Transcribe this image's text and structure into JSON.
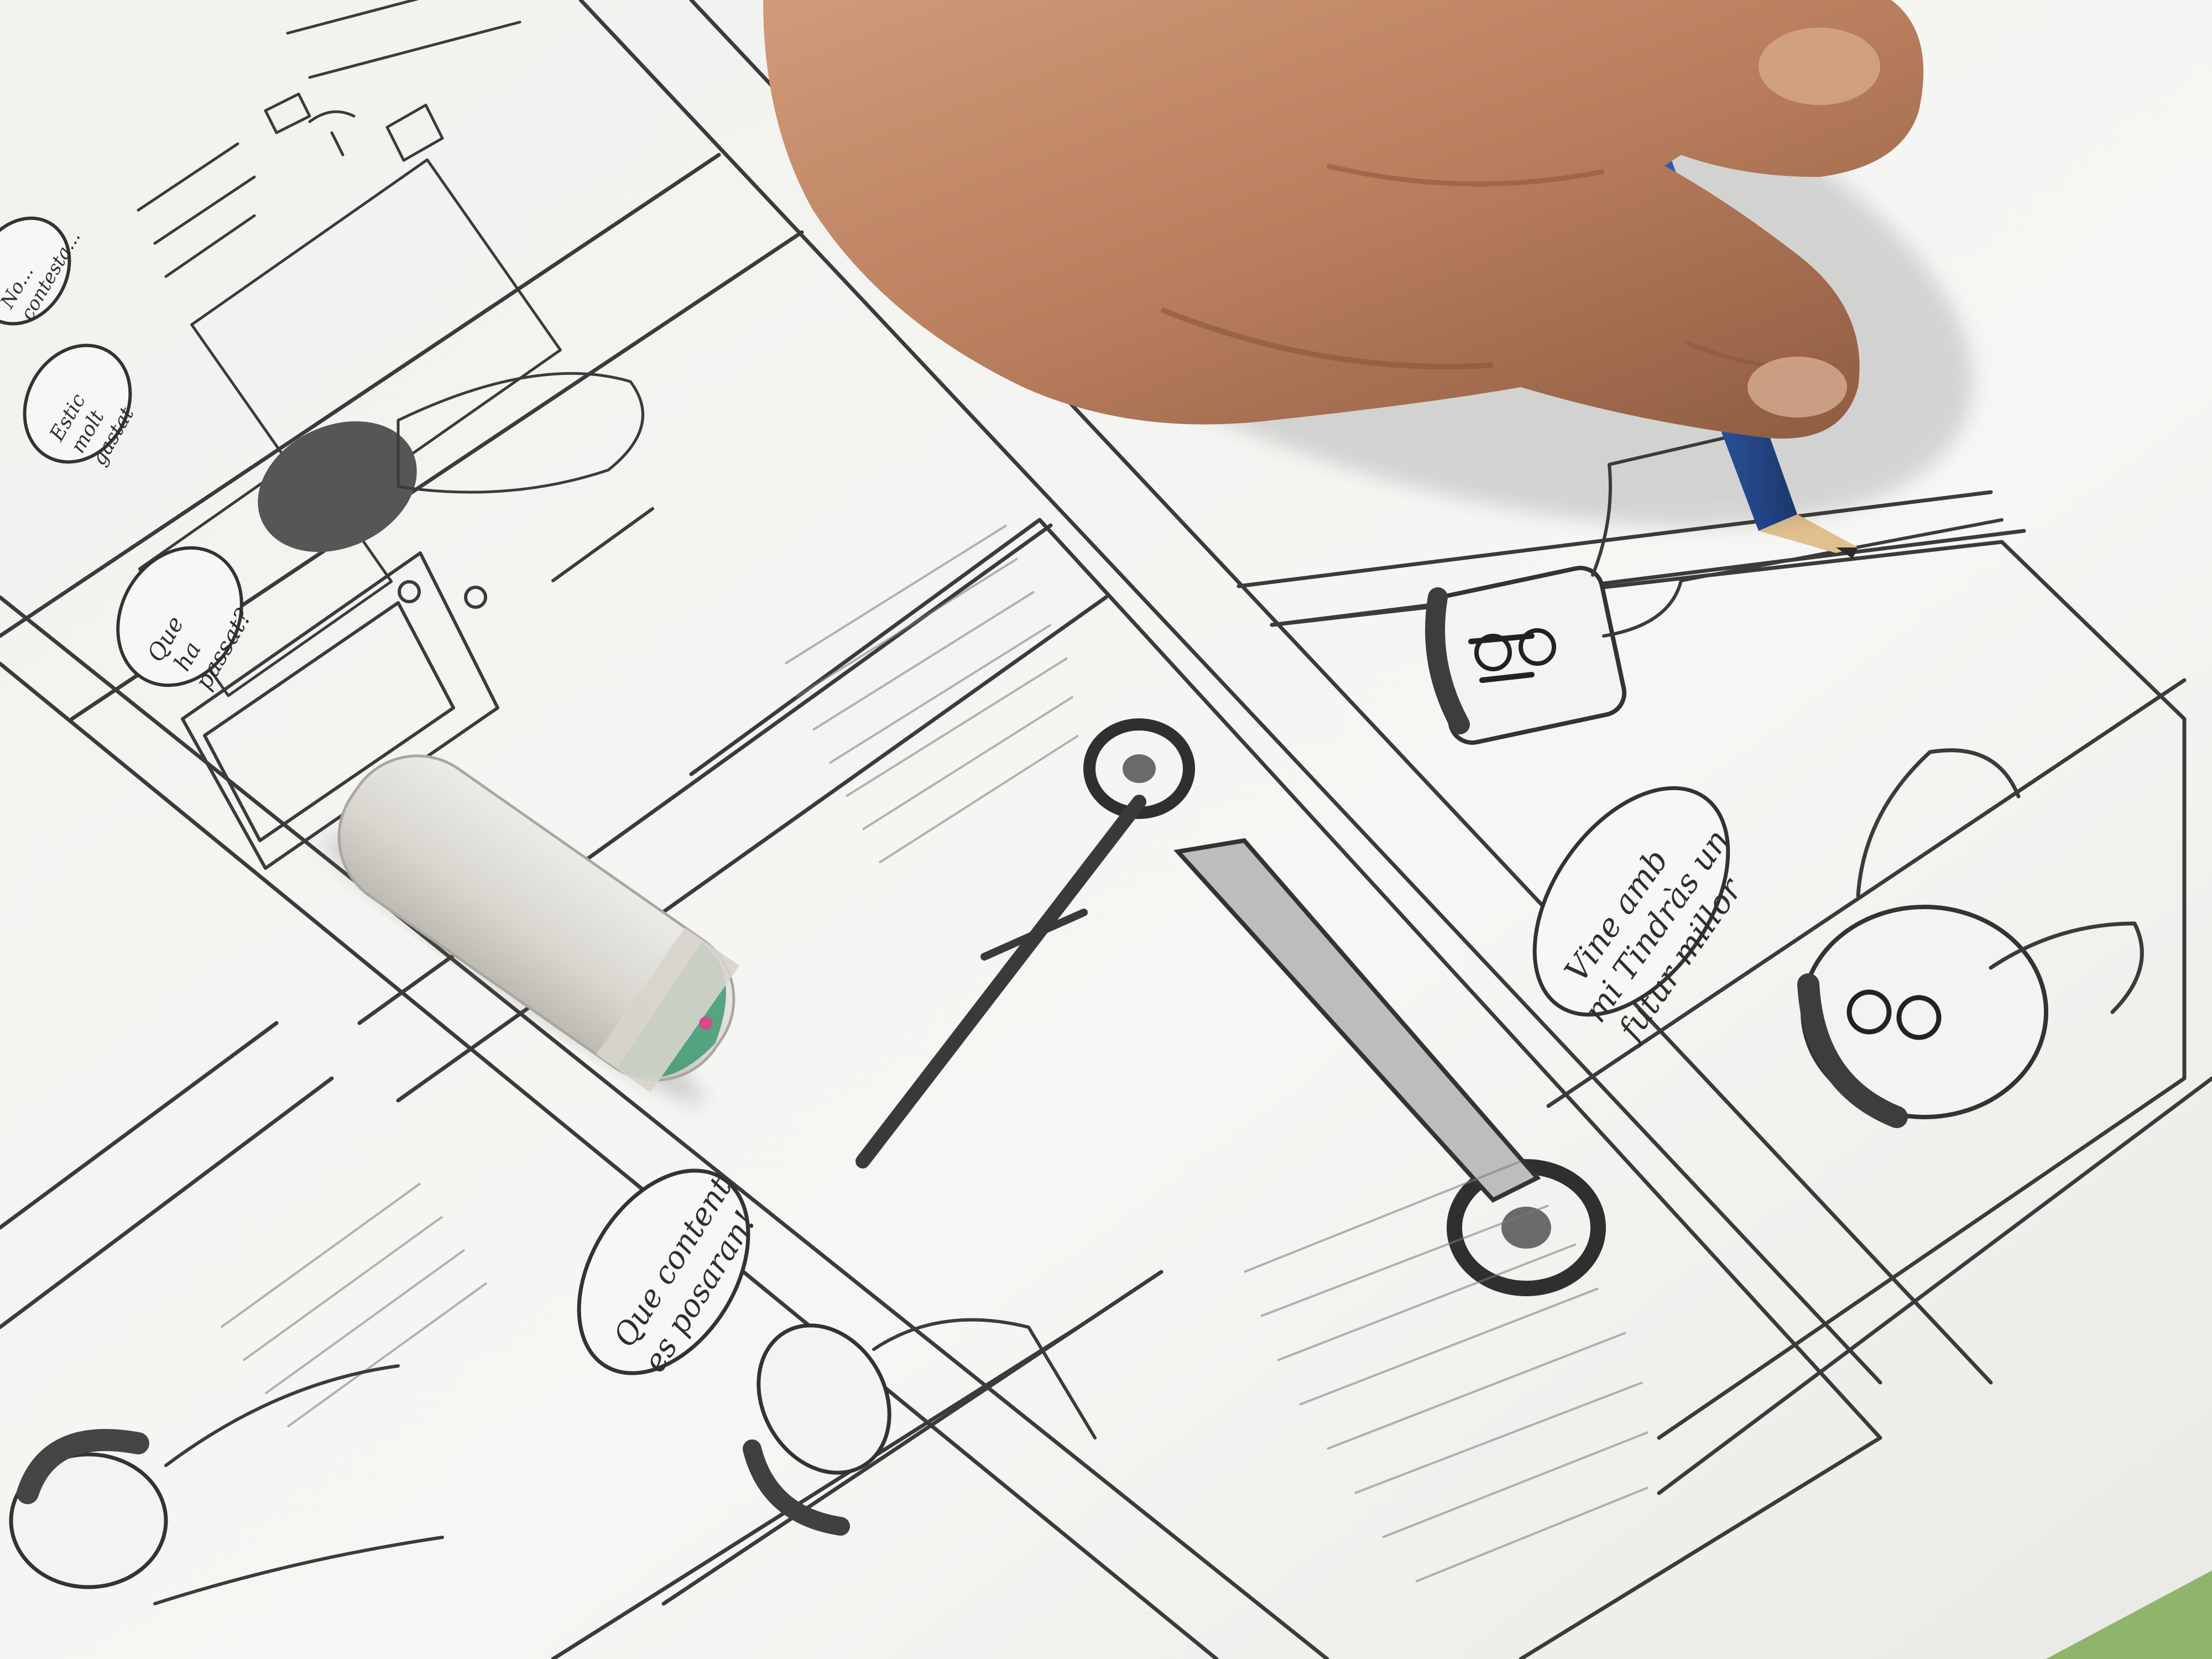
{
  "photo": {
    "subject": "photo",
    "colors": {
      "table": "#9cc07a",
      "paper": "#f4f4f2",
      "pencil_graphite": "#3b3b3b",
      "pencil_body": "#2456b8",
      "eraser": "#dcdad4",
      "skin": "#c48a68"
    }
  },
  "speech_bubbles": [
    {
      "lines": [
        "Vine amb",
        "mi Tindràs un",
        "futur millor"
      ]
    },
    {
      "lines": [
        "Que content",
        "es posaran!"
      ]
    },
    {
      "lines": [
        "Que",
        "ha",
        "passat?"
      ]
    },
    {
      "lines": [
        "Estic",
        "molt",
        "gastat"
      ]
    },
    {
      "lines": [
        "No...",
        "contesta..."
      ]
    }
  ]
}
